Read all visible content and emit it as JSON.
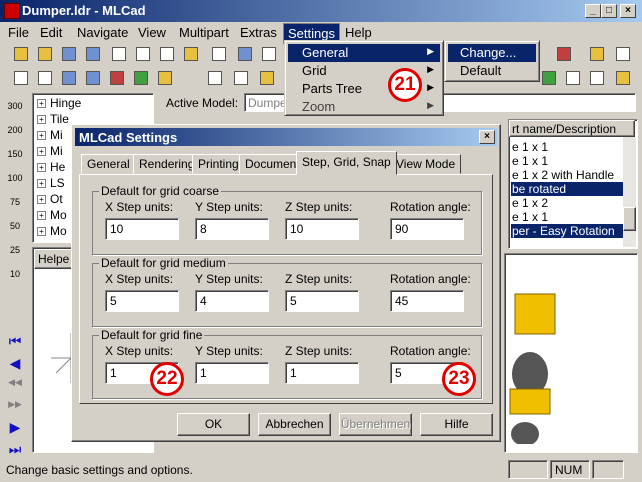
{
  "window": {
    "title": "Dumper.ldr - MLCad",
    "min": "_",
    "max": "□",
    "close": "×"
  },
  "menubar": [
    "File",
    "Edit",
    "Navigate",
    "View",
    "Multipart",
    "Extras",
    "Settings",
    "Help"
  ],
  "settings_menu": {
    "items": [
      {
        "label": "General",
        "has_sub": true
      },
      {
        "label": "Grid",
        "has_sub": true
      },
      {
        "label": "Parts Tree",
        "has_sub": true
      },
      {
        "label": "Zoom",
        "has_sub": true
      }
    ],
    "arrow": "▶"
  },
  "general_submenu": {
    "items": [
      "Change...",
      "Default"
    ]
  },
  "callouts": {
    "c21": "21",
    "c22": "22",
    "c23": "23"
  },
  "left_toolbar": {
    "zoom_labels": [
      "300",
      "200",
      "150",
      "100",
      "75",
      "50",
      "25",
      "10"
    ]
  },
  "tree": {
    "items": [
      "Hinge",
      "Tile",
      "Mi",
      "Mi",
      "He",
      "LS",
      "Ot",
      "Mo",
      "Mo"
    ],
    "expander": "+"
  },
  "active_model": {
    "label": "Active Model:",
    "value": "Dumper"
  },
  "helper_tab": "Helpe",
  "part_list": {
    "header": "rt name/Description",
    "rows": [
      {
        "text": "e  1 x 1",
        "selected": false
      },
      {
        "text": "e  1 x 1",
        "selected": false
      },
      {
        "text": "e  1 x  2 with Handle",
        "selected": false
      },
      {
        "text": "be rotated",
        "selected": true
      },
      {
        "text": "e  1 x  2",
        "selected": false
      },
      {
        "text": "e  1 x 1",
        "selected": false
      },
      {
        "text": "per - Easy Rotation",
        "selected": true
      }
    ]
  },
  "dialog": {
    "title": "MLCad Settings",
    "close": "×",
    "tabs": [
      "General",
      "Rendering",
      "Printing",
      "Document",
      "Step, Grid, Snap",
      "View Mode"
    ],
    "active_tab": 4,
    "field_labels": [
      "X Step units:",
      "Y Step units:",
      "Z Step units:",
      "Rotation angle:"
    ],
    "groups": [
      {
        "title": "Default for grid coarse",
        "values": [
          "10",
          "8",
          "10",
          "90"
        ]
      },
      {
        "title": "Default for grid medium",
        "values": [
          "5",
          "4",
          "5",
          "45"
        ]
      },
      {
        "title": "Default for grid fine",
        "values": [
          "1",
          "1",
          "1",
          "5"
        ]
      }
    ],
    "buttons": [
      {
        "label": "OK",
        "enabled": true
      },
      {
        "label": "Abbrechen",
        "enabled": true
      },
      {
        "label": "Übernehmen",
        "enabled": false
      },
      {
        "label": "Hilfe",
        "enabled": true
      }
    ]
  },
  "status": {
    "text": "Change basic settings and options.",
    "num": "NUM"
  },
  "colors": {
    "titlebar": "#0a246a",
    "callout": "#e00000",
    "brick": "#f0c000",
    "selection": "#0a246a"
  }
}
